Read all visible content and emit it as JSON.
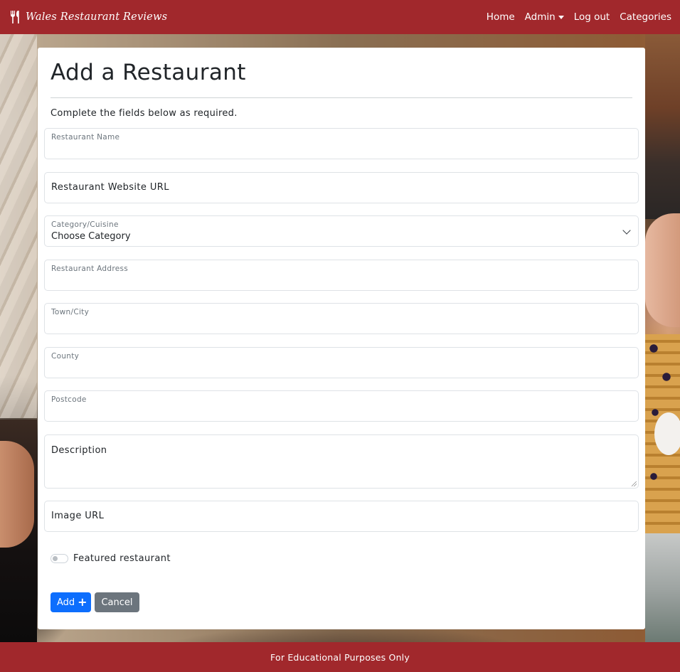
{
  "navbar": {
    "brand": "Wales Restaurant Reviews",
    "brand_icon": "utensils-icon",
    "links": {
      "home": "Home",
      "admin": "Admin",
      "logout": "Log out",
      "categories": "Categories"
    }
  },
  "form": {
    "title": "Add a Restaurant",
    "intro": "Complete the fields below as required.",
    "restaurant_name": {
      "label": "Restaurant Name",
      "value": ""
    },
    "website": {
      "label": "Restaurant Website URL",
      "value": ""
    },
    "category": {
      "label": "Category/Cuisine",
      "selected": "Choose Category"
    },
    "address": {
      "label": "Restaurant Address",
      "value": ""
    },
    "town": {
      "label": "Town/City",
      "value": ""
    },
    "county": {
      "label": "County",
      "value": ""
    },
    "postcode": {
      "label": "Postcode",
      "value": ""
    },
    "description": {
      "label": "Description",
      "value": ""
    },
    "image_url": {
      "label": "Image URL",
      "value": ""
    },
    "featured": {
      "label": "Featured restaurant",
      "checked": false
    },
    "add_button": "Add",
    "cancel_button": "Cancel"
  },
  "footer": {
    "text": "For Educational Purposes Only"
  },
  "colors": {
    "navbar": "#a1282c",
    "primary": "#0d6efd",
    "secondary": "#6c757d"
  }
}
